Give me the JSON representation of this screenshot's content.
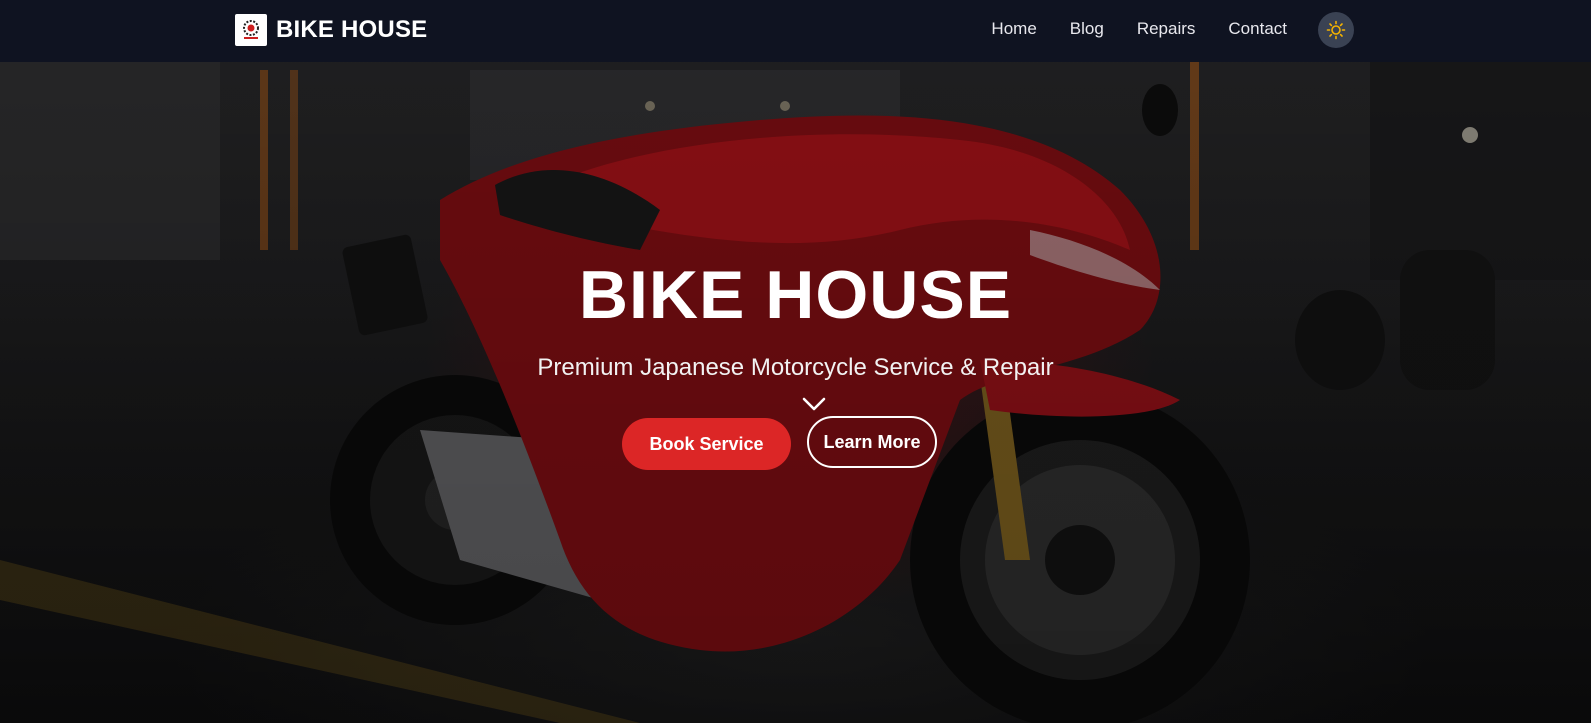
{
  "navbar": {
    "brand": "BIKE HOUSE",
    "logo_icon": "bike-house-logo",
    "links": [
      {
        "label": "Home"
      },
      {
        "label": "Blog"
      },
      {
        "label": "Repairs"
      },
      {
        "label": "Contact"
      }
    ],
    "theme_toggle_icon": "sun-icon"
  },
  "hero": {
    "title": "BIKE HOUSE",
    "subtitle": "Premium Japanese Motorcycle Service & Repair",
    "scroll_icon": "chevron-down-icon",
    "primary_button": "Book Service",
    "secondary_button": "Learn More",
    "background_image": "red sport motorcycle in dark parking garage"
  },
  "colors": {
    "navbar_bg": "#0e1321",
    "primary": "#dc2626",
    "text": "#ffffff",
    "sun": "#f5b300",
    "toggle_bg": "#3a4253"
  }
}
